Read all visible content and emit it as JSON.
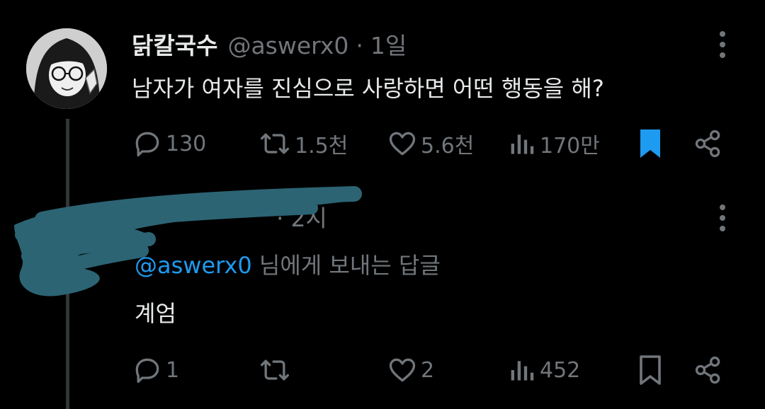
{
  "tweet": {
    "display_name": "닭칼국수",
    "handle": "@aswerx0",
    "separator": "·",
    "time": "1일",
    "text": "남자가 여자를 진심으로 사랑하면 어떤 행동을 해?",
    "stats": {
      "replies": "130",
      "retweets": "1.5천",
      "likes": "5.6천",
      "views": "170만"
    },
    "bookmarked": true
  },
  "reply": {
    "name_redacted": "",
    "time_separator": "·",
    "time": "2시",
    "reply_to_mention": "@aswerx0",
    "reply_to_suffix": " 님에게 보내는 답글",
    "text": "계엄",
    "stats": {
      "replies": "1",
      "retweets": "",
      "likes": "2",
      "views": "452"
    },
    "bookmarked": false
  },
  "colors": {
    "background": "#000000",
    "text_primary": "#e7e9ea",
    "text_secondary": "#71767b",
    "accent_blue": "#1d9bf0",
    "redaction": "#2c6474"
  },
  "icons": [
    "reply-icon",
    "retweet-icon",
    "like-icon",
    "views-icon",
    "bookmark-icon",
    "share-icon",
    "more-icon"
  ]
}
